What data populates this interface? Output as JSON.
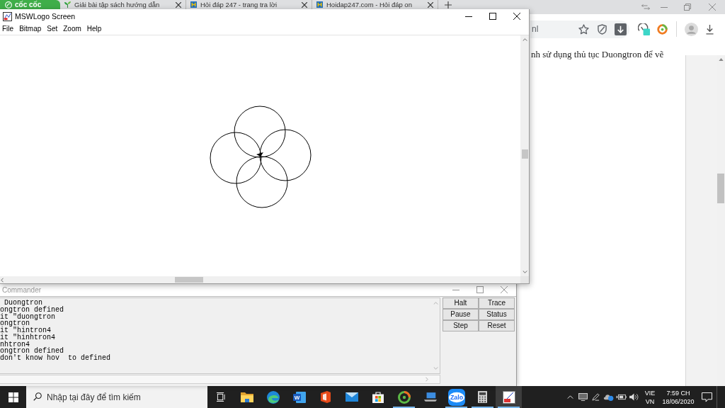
{
  "browser": {
    "brand": "cốc cốc",
    "tabs": [
      {
        "kind": "sprout",
        "title": "Giải bài tập sách hướng dẫn"
      },
      {
        "kind": "tile",
        "title": "Hỏi đáp 247 - trang tra lời"
      },
      {
        "kind": "tile",
        "title": "Hoidap247.com - Hỏi đáp on"
      }
    ],
    "address": "nl",
    "page_text": "nh sử dụng thủ tục Duongtron để vẽ"
  },
  "logo_screen": {
    "title": "MSWLogo Screen",
    "menu": [
      "File",
      "Bitmap",
      "Set",
      "Zoom",
      "Help"
    ]
  },
  "commander": {
    "title": "Commander",
    "output": [
      " Duongtron",
      "ongtron defined",
      "it \"duongtron",
      "ongtron",
      "it \"hintron4",
      "it \"hinhtron4",
      "nhtron4",
      "ongtron defined",
      "don't know hov  to defined"
    ],
    "buttons": [
      "Halt",
      "Trace",
      "Pause",
      "Status",
      "Step",
      "Reset"
    ]
  },
  "taskbar": {
    "search_placeholder": "Nhập tại đây để tìm kiếm",
    "apps": [
      {
        "kind": "explorer",
        "running": false,
        "selected": false
      },
      {
        "kind": "edge",
        "running": false,
        "selected": false
      },
      {
        "kind": "word",
        "label": "W",
        "running": false,
        "selected": false
      },
      {
        "kind": "office",
        "running": false,
        "selected": false
      },
      {
        "kind": "mail",
        "running": false,
        "selected": false
      },
      {
        "kind": "store",
        "running": false,
        "selected": false
      },
      {
        "kind": "disc",
        "running": true,
        "selected": false
      },
      {
        "kind": "laptop",
        "running": false,
        "selected": false
      },
      {
        "kind": "zalo",
        "label": "Zalo",
        "running": true,
        "selected": false
      },
      {
        "kind": "calculator",
        "running": true,
        "selected": false
      },
      {
        "kind": "logo",
        "running": true,
        "selected": true
      }
    ],
    "language": "VIE",
    "region": "VN",
    "time": "7:59 CH",
    "date": "18/06/2020"
  }
}
